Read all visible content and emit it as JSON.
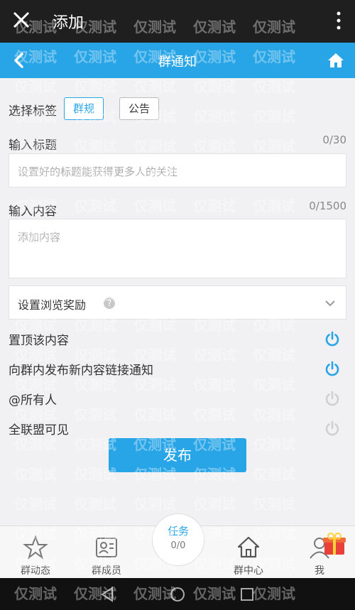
{
  "statusbar": {
    "title": "添加"
  },
  "navbar": {
    "title": "群通知"
  },
  "tags": {
    "label": "选择标签",
    "items": [
      "群规",
      "公告"
    ]
  },
  "title_field": {
    "label": "输入标题",
    "counter": "0/30",
    "placeholder": "设置好的标题能获得更多人的关注"
  },
  "content_field": {
    "label": "输入内容",
    "counter": "0/1500",
    "placeholder": "添加内容"
  },
  "reward": {
    "label": "设置浏览奖励",
    "help": "?"
  },
  "options": [
    {
      "label": "置顶该内容",
      "enabled": true
    },
    {
      "label": "向群内发布新内容链接通知",
      "enabled": true
    },
    {
      "label": "@所有人",
      "enabled": false
    },
    {
      "label": "全联盟可见",
      "enabled": false
    }
  ],
  "publish_label": "发布",
  "bottom_nav": {
    "items": [
      "群动态",
      "群成员",
      "群中心",
      "我"
    ],
    "task": {
      "label": "任务",
      "count": "0/0"
    }
  },
  "watermark": "仅测试",
  "colors": {
    "accent": "#27a5e6",
    "topbar": "#1f1f1f",
    "power_on": "#27a5e6",
    "power_off": "#d0d0d0"
  }
}
